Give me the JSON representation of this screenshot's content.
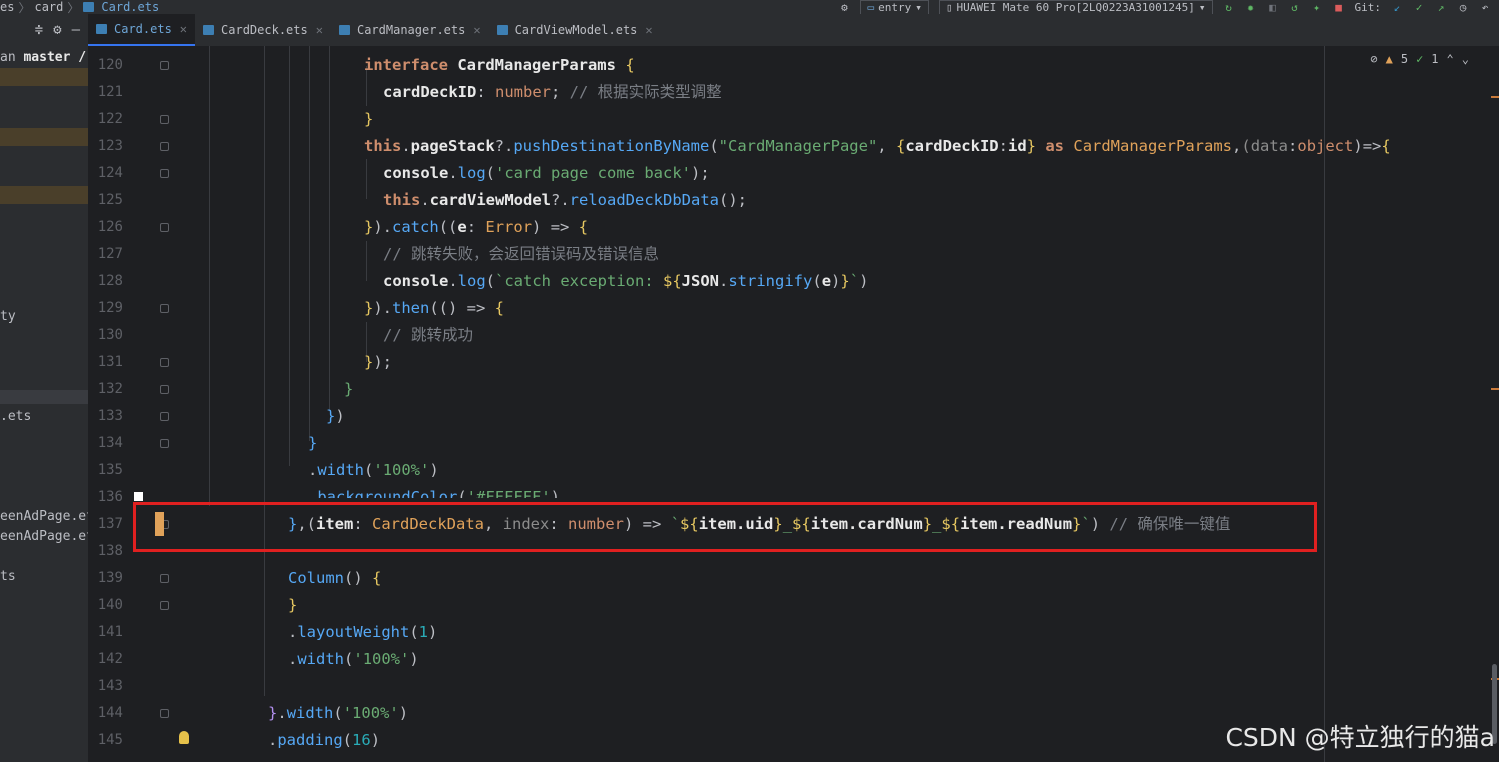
{
  "breadcrumb": {
    "items": [
      "es",
      "card",
      "Card.ets"
    ]
  },
  "toolbar": {
    "module": "entry",
    "device": "HUAWEI Mate 60 Pro[2LQ0223A31001245]",
    "git_label": "Git:"
  },
  "tabs": [
    {
      "label": "Card.ets",
      "active": true
    },
    {
      "label": "CardDeck.ets",
      "active": false
    },
    {
      "label": "CardManager.ets",
      "active": false
    },
    {
      "label": "CardViewModel.ets",
      "active": false
    }
  ],
  "project_panel": {
    "branch_prefix": "an",
    "branch": "master /",
    "items": [
      "ty",
      ".ets",
      "eenAdPage.et",
      "eenAdPage.et",
      "ts"
    ]
  },
  "inspections": {
    "warnings": "5",
    "checks": "1"
  },
  "line_numbers": [
    "120",
    "121",
    "122",
    "123",
    "124",
    "125",
    "126",
    "127",
    "128",
    "129",
    "130",
    "131",
    "132",
    "133",
    "134",
    "135",
    "136",
    "137",
    "138",
    "139",
    "140",
    "141",
    "142",
    "143",
    "144",
    "145"
  ],
  "code": {
    "l120_kw": "interface",
    "l120_name": " CardManagerParams ",
    "l121_prop": "cardDeckID",
    "l121_type": "number",
    "l121_comment": "// 根据实际类型调整",
    "l123_this": "this",
    "l123_prop": "pageStack",
    "l123_fn": "pushDestinationByName",
    "l123_str": "\"CardManagerPage\"",
    "l123_obj": "cardDeckID",
    "l123_id": "id",
    "l123_as": "as",
    "l123_type": "CardManagerParams",
    "l123_param": "data",
    "l123_ptype": "object",
    "l124_obj": "console",
    "l124_fn": "log",
    "l124_str": "'card page come back'",
    "l125_this": "this",
    "l125_prop": "cardViewModel",
    "l125_fn": "reloadDeckDbData",
    "l126_fn": "catch",
    "l126_param": "e",
    "l126_type": "Error",
    "l127_comment": "// 跳转失败，会返回错误码及错误信息",
    "l128_obj": "console",
    "l128_fn": "log",
    "l128_str1": "`catch exception: ",
    "l128_json": "JSON",
    "l128_fn2": "stringify",
    "l128_e": "e",
    "l129_fn": "then",
    "l130_comment": "// 跳转成功",
    "l135_fn": "width",
    "l135_str": "'100%'",
    "l136_fn": "backgroundColor",
    "l136_str": "'#FFFFFF'",
    "l137_item": "item",
    "l137_type": "CardDeckData",
    "l137_index": "index",
    "l137_ntype": "number",
    "l137_uid": "item.uid",
    "l137_cardNum": "item.cardNum",
    "l137_readNum": "item.readNum",
    "l137_comment": "// 确保唯一键值",
    "l139_fn": "Column",
    "l141_fn": "layoutWeight",
    "l141_num": "1",
    "l142_fn": "width",
    "l142_str": "'100%'",
    "l144_fn": "width",
    "l144_str": "'100%'",
    "l145_fn": "padding",
    "l145_num": "16"
  },
  "watermark": "CSDN @特立独行的猫a",
  "colors": {
    "accent": "#3574f0",
    "highlight_box": "#e02020",
    "warning": "#e0a25a"
  }
}
